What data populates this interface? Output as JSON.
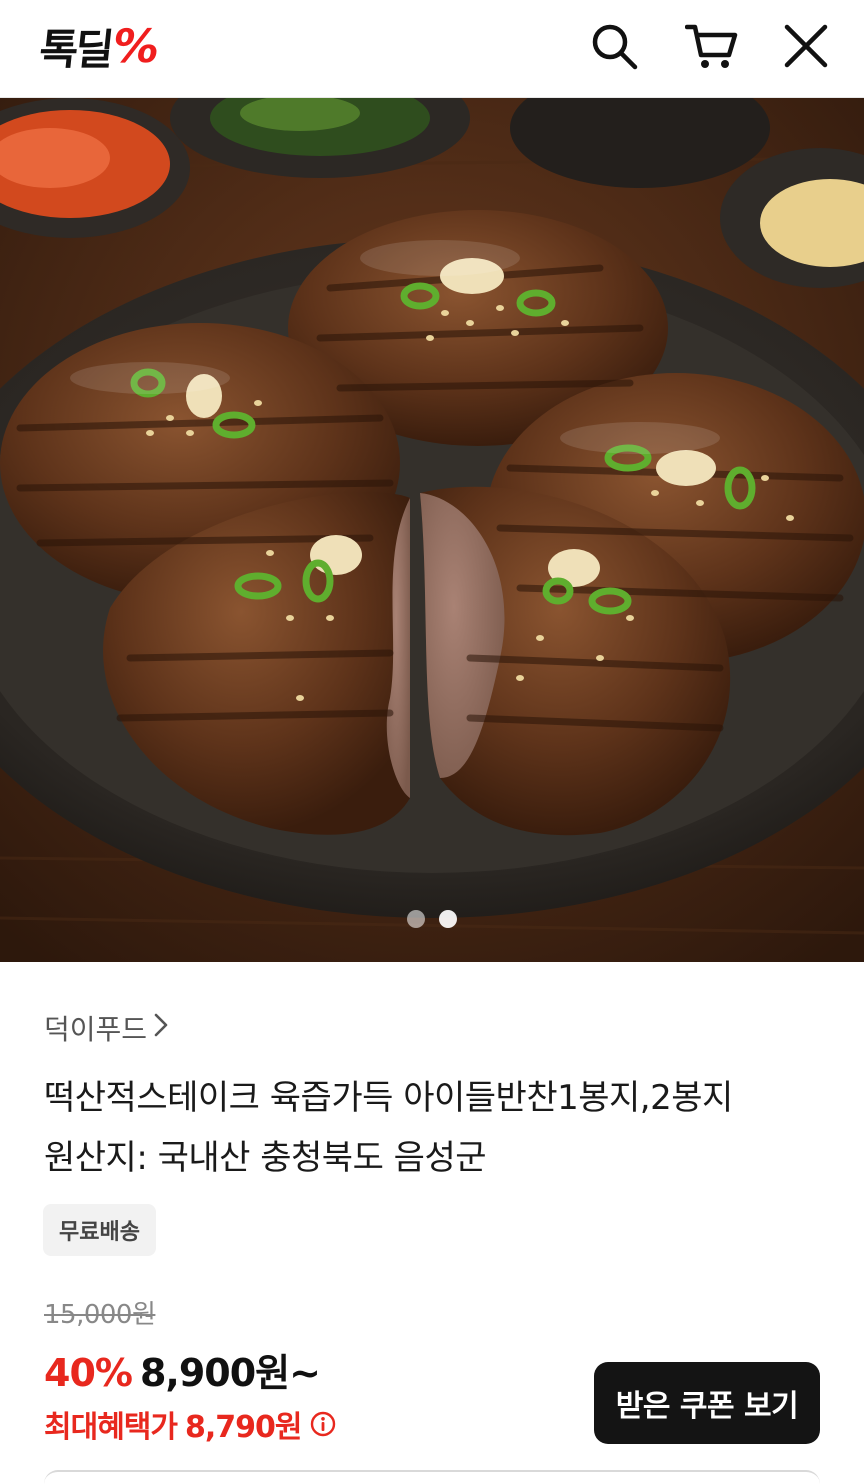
{
  "header": {
    "logo_text": "톡딜",
    "logo_mark": "%",
    "icons": {
      "search": "search-icon",
      "cart": "cart-icon",
      "close": "close-icon"
    },
    "colors": {
      "brand_red": "#f01e1e"
    }
  },
  "hero": {
    "slide_count": 2,
    "active_slide": 2
  },
  "product": {
    "seller": "덕이푸드",
    "title_line1": "떡산적스테이크 육즙가득 아이들반찬1봉지,2봉지",
    "title_line2": "원산지: 국내산 충청북도 음성군",
    "badge": "무료배송",
    "original_price": "15,000원",
    "discount": "40%",
    "sale_price": "8,900원~",
    "benefit_label": "최대혜택가",
    "benefit_price": "8,790원",
    "coupon_button": "받은 쿠폰 보기"
  },
  "colors": {
    "discount_red": "#e8281e",
    "button_dark": "#141414"
  }
}
